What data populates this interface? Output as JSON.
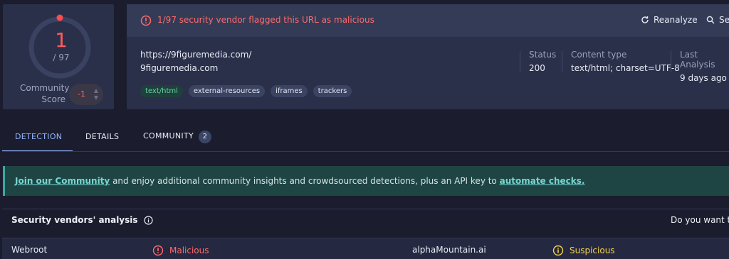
{
  "community_score": {
    "detections": "1",
    "total": "/ 97",
    "label": "Community Score",
    "score": "-1",
    "colors": {
      "detections": "#ff5b5b",
      "ring_track": "#3a4262",
      "ring_marker": "#ff4d4d"
    }
  },
  "alert": {
    "text": "1/97 security vendor flagged this URL as malicious",
    "color": "#ff6b6b",
    "icon": "alert-circle-icon"
  },
  "actions": {
    "reanalyze_label": "Reanalyze",
    "reanalyze_icon": "refresh-icon",
    "search_label": "Se",
    "search_icon": "search-icon"
  },
  "url_info": {
    "url": "https://9figuremedia.com/",
    "domain": "9figuremedia.com",
    "tags": [
      "text/html",
      "external-resources",
      "iframes",
      "trackers"
    ]
  },
  "meta": [
    {
      "label": "Status",
      "value": "200"
    },
    {
      "label": "Content type",
      "value": "text/html; charset=UTF-8"
    },
    {
      "label": "Last Analysis",
      "value": "9 days ago"
    }
  ],
  "tabs": [
    {
      "label": "DETECTION",
      "active": true
    },
    {
      "label": "DETAILS",
      "active": false
    },
    {
      "label": "COMMUNITY",
      "active": false,
      "badge": "2"
    }
  ],
  "banner": {
    "link1": "Join our Community",
    "middle": " and enjoy additional community insights and crowdsourced detections, plus an API key to ",
    "link2": "automate checks."
  },
  "vendors": {
    "title": "Security vendors' analysis",
    "right_text": "Do you want to a",
    "rows": [
      {
        "vendor": "Webroot",
        "verdict": "Malicious",
        "vendor2": "alphaMountain.ai",
        "verdict2": "Suspicious"
      }
    ]
  }
}
